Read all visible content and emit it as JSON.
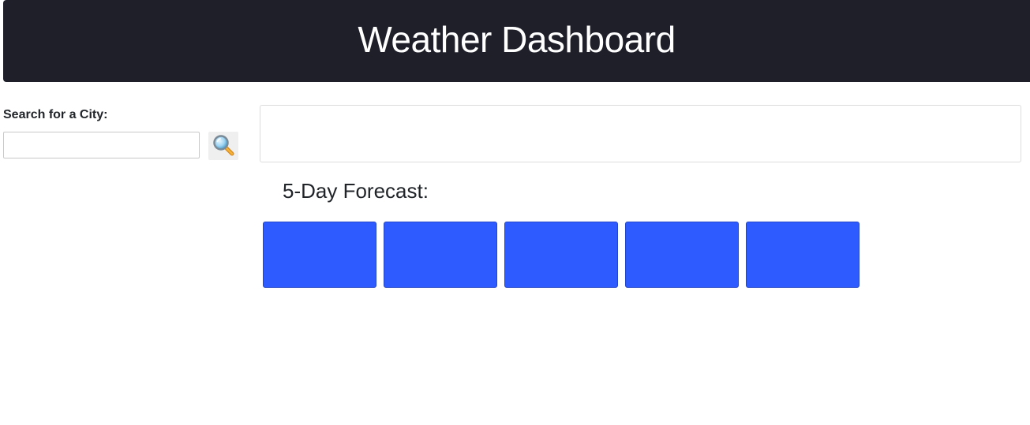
{
  "header": {
    "title": "Weather Dashboard"
  },
  "search": {
    "label": "Search for a City:",
    "value": "",
    "placeholder": "",
    "button_icon": "search-icon"
  },
  "current_weather": {
    "content": ""
  },
  "forecast": {
    "title": "5-Day Forecast:",
    "cards": [
      {
        "text": ""
      },
      {
        "text": ""
      },
      {
        "text": ""
      },
      {
        "text": ""
      },
      {
        "text": ""
      }
    ]
  },
  "colors": {
    "header_bg": "#1f1f2a",
    "card_bg": "#2e5bff"
  }
}
